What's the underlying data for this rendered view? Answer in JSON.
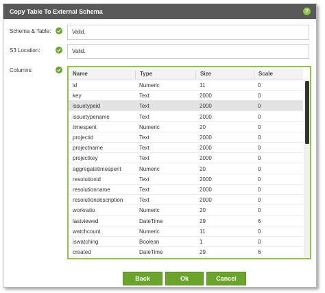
{
  "dialog": {
    "title": "Copy Table To External Schema",
    "help_icon": "?"
  },
  "form": {
    "schema_label": "Schema & Table:",
    "schema_value": "Valid.",
    "s3_label": "S3 Location:",
    "s3_value": "Valid.",
    "columns_label": "Columns:"
  },
  "table": {
    "headers": [
      "Name",
      "Type",
      "Size",
      "Scale"
    ],
    "rows": [
      [
        "id",
        "Numeric",
        "11",
        "0"
      ],
      [
        "key",
        "Text",
        "2000",
        "0"
      ],
      [
        "issuetypeid",
        "Text",
        "2000",
        "0"
      ],
      [
        "issuetypename",
        "Text",
        "2000",
        "0"
      ],
      [
        "timespent",
        "Numeric",
        "20",
        "0"
      ],
      [
        "projectid",
        "Text",
        "2000",
        "0"
      ],
      [
        "projectname",
        "Text",
        "2000",
        "0"
      ],
      [
        "projectkey",
        "Text",
        "2000",
        "0"
      ],
      [
        "aggregatetimespent",
        "Numeric",
        "20",
        "0"
      ],
      [
        "resolutionid",
        "Text",
        "2000",
        "0"
      ],
      [
        "resolutionname",
        "Text",
        "2000",
        "0"
      ],
      [
        "resolutiondescription",
        "Text",
        "2000",
        "0"
      ],
      [
        "workratio",
        "Numeric",
        "20",
        "0"
      ],
      [
        "lastviewed",
        "DateTime",
        "29",
        "6"
      ],
      [
        "watchcount",
        "Numeric",
        "11",
        "0"
      ],
      [
        "iswatching",
        "Boolean",
        "1",
        "0"
      ],
      [
        "created",
        "DateTime",
        "29",
        "6"
      ]
    ],
    "selected_row": 2
  },
  "buttons": {
    "back": "Back",
    "ok": "Ok",
    "cancel": "Cancel"
  },
  "colors": {
    "accent": "#6aa52b",
    "titlebar": "#595959",
    "selected_row": "#e3e3e3"
  }
}
